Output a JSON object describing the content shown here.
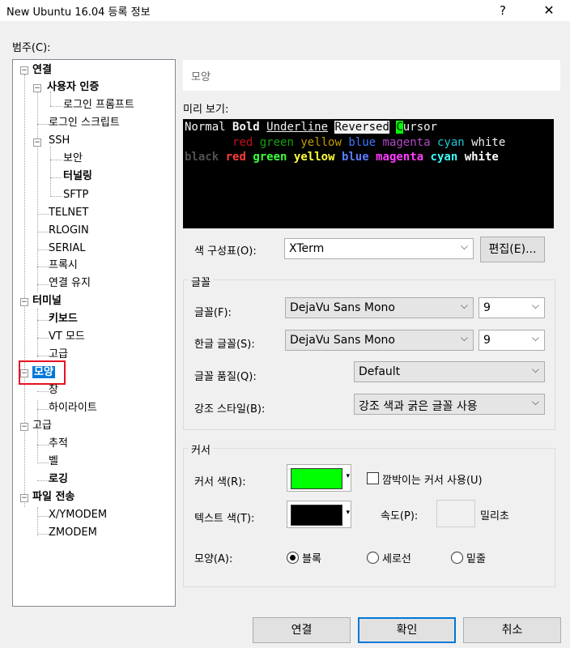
{
  "window": {
    "title": "New Ubuntu 16.04 등록 정보",
    "help_glyph": "?",
    "close_glyph": "✕"
  },
  "category_label": "범주(C):",
  "tree": [
    {
      "label": "연결"
    },
    {
      "label": "사용자 인증"
    },
    {
      "label": "로그인 프롬프트"
    },
    {
      "label": "로그인 스크립트"
    },
    {
      "label": "SSH"
    },
    {
      "label": "보안"
    },
    {
      "label": "터널링"
    },
    {
      "label": "SFTP"
    },
    {
      "label": "TELNET"
    },
    {
      "label": "RLOGIN"
    },
    {
      "label": "SERIAL"
    },
    {
      "label": "프록시"
    },
    {
      "label": "연결 유지"
    },
    {
      "label": "터미널"
    },
    {
      "label": "키보드"
    },
    {
      "label": "VT 모드"
    },
    {
      "label": "고급"
    },
    {
      "label": "모양"
    },
    {
      "label": "창"
    },
    {
      "label": "하이라이트"
    },
    {
      "label": "고급"
    },
    {
      "label": "추적"
    },
    {
      "label": "벨"
    },
    {
      "label": "로깅"
    },
    {
      "label": "파일 전송"
    },
    {
      "label": "X/YMODEM"
    },
    {
      "label": "ZMODEM"
    }
  ],
  "section_header": "모양",
  "preview": {
    "label": "미리 보기:",
    "line1": {
      "normal": "Normal",
      "bold": "Bold",
      "underline": "Underline",
      "reversed": "Reversed",
      "cursor_char": "C",
      "cursor_rest": "ursor"
    },
    "line2": [
      "red",
      "green",
      "yellow",
      "blue",
      "magenta",
      "cyan",
      "white"
    ],
    "line3": [
      "black",
      "red",
      "green",
      "yellow",
      "blue",
      "magenta",
      "cyan",
      "white"
    ],
    "colors": {
      "red": "#c50f1f",
      "green": "#13a10e",
      "yellow": "#c19c00",
      "blue": "#3b78ff",
      "magenta": "#b148c6",
      "cyan": "#1ec6d6",
      "white": "#f2f2f2",
      "black": "#505050",
      "b_red": "#ff3b3b",
      "b_green": "#3bff3b",
      "b_yellow": "#ffff3b",
      "b_blue": "#5c7cff",
      "b_magenta": "#ff3bff",
      "b_cyan": "#3bffff",
      "b_white": "#ffffff"
    }
  },
  "color_scheme": {
    "label": "색 구성표(O):",
    "value": "XTerm",
    "edit_button": "편집(E)..."
  },
  "font_group": {
    "title": "글꼴",
    "font_label": "글꼴(F):",
    "font_value": "DejaVu Sans Mono",
    "font_size": "9",
    "korean_font_label": "한글 글꼴(S):",
    "korean_font_value": "DejaVu Sans Mono",
    "korean_font_size": "9",
    "quality_label": "글꼴 품질(Q):",
    "quality_value": "Default",
    "emphasis_label": "강조 스타일(B):",
    "emphasis_value": "강조 색과 굵은 글꼴 사용"
  },
  "cursor_group": {
    "title": "커서",
    "cursor_color_label": "커서 색(R):",
    "cursor_color": "#00ff00",
    "blink_label": "깜박이는 커서 사용(U)",
    "blink_checked": false,
    "text_color_label": "텍스트 색(T):",
    "text_color": "#000000",
    "speed_label": "속도(P):",
    "speed_unit": "밀리초",
    "shape_label": "모양(A):",
    "shapes": [
      {
        "label": "블록",
        "selected": true
      },
      {
        "label": "세로선",
        "selected": false
      },
      {
        "label": "밑줄",
        "selected": false
      }
    ]
  },
  "buttons": {
    "connect": "연결",
    "ok": "확인",
    "cancel": "취소"
  },
  "dropdown_arrow": "⌵",
  "highlight_color": "#e81123",
  "selection_color": "#0078d7"
}
